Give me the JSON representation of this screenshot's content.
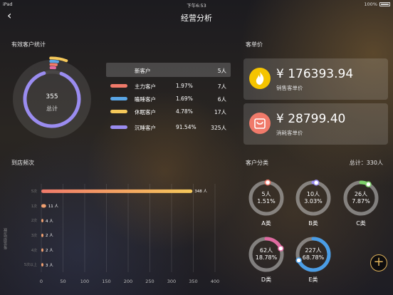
{
  "status_bar": {
    "device": "iPad",
    "time": "下午6:53",
    "battery": "100%"
  },
  "nav": {
    "back_glyph": "‹",
    "title": "经营分析"
  },
  "effective_customers": {
    "title": "有效客户统计",
    "total_value": "355",
    "total_label": "总计",
    "header_row": {
      "name": "新客户",
      "count": "5人"
    },
    "rows": [
      {
        "name": "主力客户",
        "percent": "1.97%",
        "count": "7人",
        "fraction": 0.0197,
        "color": "#f07a6a"
      },
      {
        "name": "瞌睡客户",
        "percent": "1.69%",
        "count": "6人",
        "fraction": 0.0169,
        "color": "#5aa6e6"
      },
      {
        "name": "休眠客户",
        "percent": "4.78%",
        "count": "17人",
        "fraction": 0.0478,
        "color": "#f5c85a"
      },
      {
        "name": "沉睡客户",
        "percent": "91.54%",
        "count": "325人",
        "fraction": 0.9154,
        "color": "#9a8cf0"
      }
    ],
    "new_fraction": 0.014,
    "new_color": "#e06aa0"
  },
  "unit_price": {
    "title": "客单价",
    "cards": [
      {
        "amount": "¥ 176393.94",
        "label": "销售客单价",
        "icon": "flame-icon",
        "icon_color": "#f5c400"
      },
      {
        "amount": "¥ 28799.40",
        "label": "消耗客单价",
        "icon": "shopping-bag-icon",
        "icon_color": "#f07a6a"
      }
    ]
  },
  "visit_frequency": {
    "title": "到店频次",
    "chart_data": {
      "type": "bar",
      "orientation": "horizontal",
      "title": "",
      "categories": [
        "5次",
        "1次",
        "2次",
        "3次",
        "4次",
        "5次以上"
      ],
      "values": [
        348,
        11,
        4,
        2,
        2,
        3
      ],
      "value_labels": [
        "348 人",
        "11 人",
        "4 人",
        "2 人",
        "2 人",
        "3 人"
      ],
      "xlim": [
        0,
        400
      ],
      "xticks": [
        "0",
        "50",
        "100",
        "150",
        "200",
        "250",
        "300",
        "350",
        "400"
      ],
      "ylabel": "每位到店次数",
      "grid": true
    }
  },
  "customer_class": {
    "title": "客户分类",
    "total": "总计：330人",
    "items": [
      {
        "count": "5人",
        "percent": "1.51%",
        "label": "A类",
        "fraction": 0.0151,
        "color": "#f07a6a"
      },
      {
        "count": "10人",
        "percent": "3.03%",
        "label": "B类",
        "fraction": 0.0303,
        "color": "#9a8cf0"
      },
      {
        "count": "26人",
        "percent": "7.87%",
        "label": "C类",
        "fraction": 0.0787,
        "color": "#7dd06a"
      },
      {
        "count": "62人",
        "percent": "18.78%",
        "label": "D类",
        "fraction": 0.1878,
        "color": "#e06aa0"
      },
      {
        "count": "227人",
        "percent": "68.78%",
        "label": "E类",
        "fraction": 0.6878,
        "color": "#4a9de6"
      }
    ]
  },
  "fab": {
    "glyph": "+"
  }
}
